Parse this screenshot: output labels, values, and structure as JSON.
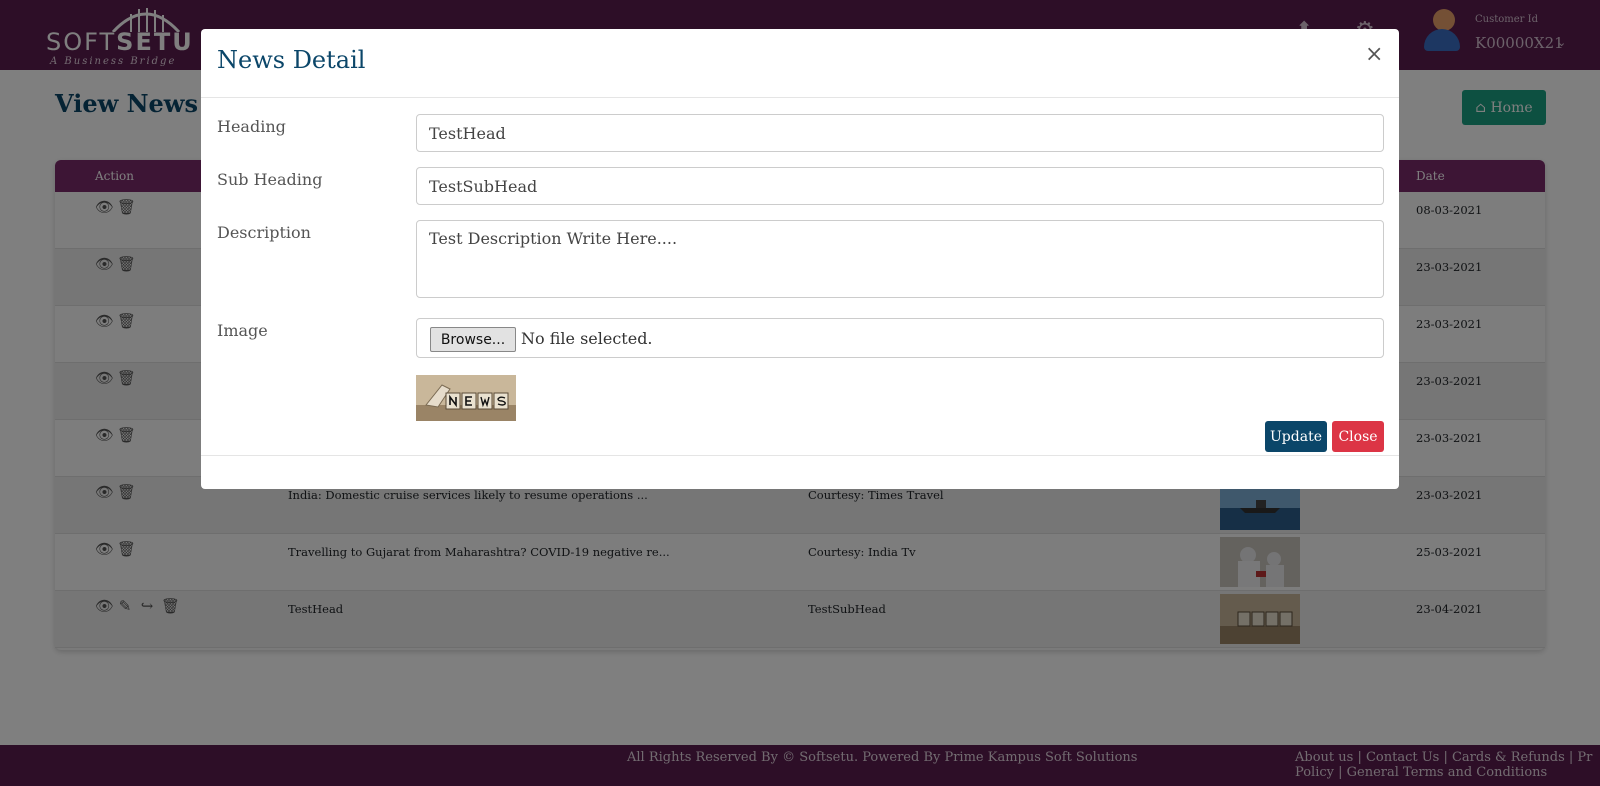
{
  "header": {
    "logo_part1": "SOFT",
    "logo_part2": "SETU",
    "logo_tagline": "A Business Bridge",
    "customer_label": "Customer Id",
    "customer_id": "K00000X21"
  },
  "page": {
    "title": "View News",
    "home_button": "Home"
  },
  "table": {
    "headers": {
      "action": "Action",
      "date": "Date"
    },
    "rows": [
      {
        "heading": "",
        "subheading": "",
        "date": "08-03-2021",
        "image": ""
      },
      {
        "heading": "",
        "subheading": "",
        "date": "23-03-2021",
        "image": ""
      },
      {
        "heading": "",
        "subheading": "",
        "date": "23-03-2021",
        "image": ""
      },
      {
        "heading": "",
        "subheading": "",
        "date": "23-03-2021",
        "image": ""
      },
      {
        "heading": "",
        "subheading": "",
        "date": "23-03-2021",
        "image": ""
      },
      {
        "heading": "India: Domestic cruise services likely to resume operations ...",
        "subheading": "Courtesy: Times Travel",
        "date": "23-03-2021",
        "image": "ship"
      },
      {
        "heading": "Travelling to Gujarat from Maharashtra? COVID-19 negative re...",
        "subheading": "Courtesy: India Tv",
        "date": "25-03-2021",
        "image": "covid"
      },
      {
        "heading": "TestHead",
        "subheading": "TestSubHead",
        "date": "23-04-2021",
        "image": "news"
      }
    ]
  },
  "footer": {
    "copyright": "All Rights Reserved By © Softsetu. Powered By Prime Kampus Soft Solutions",
    "links_line1": "About us | Contact Us | Cards & Refunds | Pr",
    "links_line2": "Policy | General Terms and Conditions"
  },
  "modal": {
    "title": "News Detail",
    "close_icon": "×",
    "fields": {
      "heading_label": "Heading",
      "heading_value": "TestHead",
      "subheading_label": "Sub Heading",
      "subheading_value": "TestSubHead",
      "description_label": "Description",
      "description_value": "Test Description Write Here....",
      "image_label": "Image",
      "browse_button": "Browse...",
      "file_status": "No file selected."
    },
    "update_button": "Update",
    "close_button": "Close"
  },
  "colors": {
    "header_bg": "#5a1d4f",
    "table_header_bg": "#7a2a6b",
    "title_blue": "#0b4669",
    "home_green": "#1aa182",
    "close_red": "#dc3545"
  }
}
